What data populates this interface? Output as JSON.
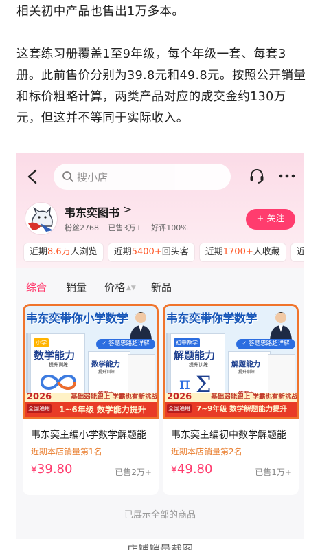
{
  "article": {
    "paragraph1": "相关初中产品也售出1万多本。",
    "paragraph2": "这套练习册覆盖1至9年级，每个年级一套、每套3册。此前售价分别为39.8元和49.8元。按照公开销量和标价粗略计算，两类产品对应的成交金约130万元，但这并不等同于实际收入。",
    "caption": "店铺销量截图"
  },
  "header": {
    "search_placeholder": "搜小店"
  },
  "shop": {
    "name": "韦东奕图书",
    "chevron": ">",
    "fans": "粉丝2768",
    "sold": "已售3万+",
    "rating": "好评100%",
    "follow_label": "+ 关注"
  },
  "chips": [
    {
      "pre": "近期",
      "num": "8.6万",
      "post": "人浏览"
    },
    {
      "pre": "近期",
      "num": "5400+",
      "post": "回头客"
    },
    {
      "pre": "近期",
      "num": "1700+",
      "post": "人收藏"
    },
    {
      "pre": "近",
      "num": "",
      "post": ""
    }
  ],
  "sort_tabs": [
    "综合",
    "销量",
    "价格",
    "新品"
  ],
  "products": [
    {
      "cover_title": "韦东奕带你小学数学",
      "cover_badge": "✓ 答题思路超详解",
      "book_tag": "小学",
      "book_title": "数学能力",
      "book_sub": "提升训练",
      "small_title": "数学能力",
      "small_sub": "提升训练",
      "small_ans": "答案本",
      "banner_top": "基础弱能跟上 学霸也有新挑战",
      "year": "2026",
      "national": "全国通用",
      "banner_main": "1~6年级 数学能力提升",
      "title": "韦东奕主编小学数学解题能",
      "rank": "近期本店销量第1名",
      "price_currency": "¥",
      "price": "39.80",
      "sold": "已售2万+"
    },
    {
      "cover_title": "韦东奕带你学数学",
      "cover_badge": "✓ 答题思路超详解",
      "book_tag": "初中数学",
      "book_title": "解题能力",
      "book_sub": "提升训练",
      "small_title": "解题能力",
      "small_sub": "提升训练",
      "small_ans": "答案本",
      "banner_top": "基础弱能跟上 学霸也有新挑战",
      "year": "2026",
      "national": "全国通用",
      "banner_main": "7~9年级 数学解题能力提升",
      "title": "韦东奕主编初中数学解题能",
      "rank": "近期本店销量第2名",
      "price_currency": "¥",
      "price": "49.80",
      "sold": "已售1万+"
    }
  ],
  "footer_note": "已展示全部的商品",
  "colors": {
    "accent": "#ff3c6e",
    "highlight": "#ff5a2a",
    "rank": "#e87b2a"
  }
}
